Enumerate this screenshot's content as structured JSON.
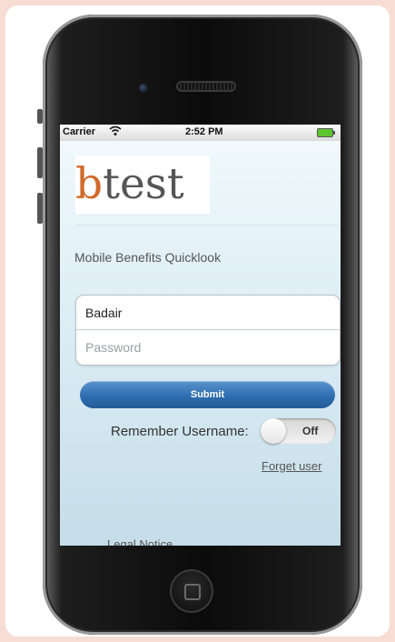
{
  "status_bar": {
    "carrier": "Carrier",
    "wifi_icon": "wifi-icon",
    "time": "2:52 PM",
    "battery_icon": "battery-icon"
  },
  "app": {
    "logo_b": "b",
    "logo_rest": "test",
    "subtitle": "Mobile Benefits Quicklook",
    "username_value": "Badair",
    "password_placeholder": "Password",
    "submit_label": "Submit",
    "remember_label": "Remember Username:",
    "toggle_state": "Off",
    "forget_link": "Forget user",
    "legal_link": "Legal Notice"
  },
  "colors": {
    "accent": "#2f6eaf",
    "logo_b": "#d06a2a",
    "page_background": "#f7ddd3"
  }
}
